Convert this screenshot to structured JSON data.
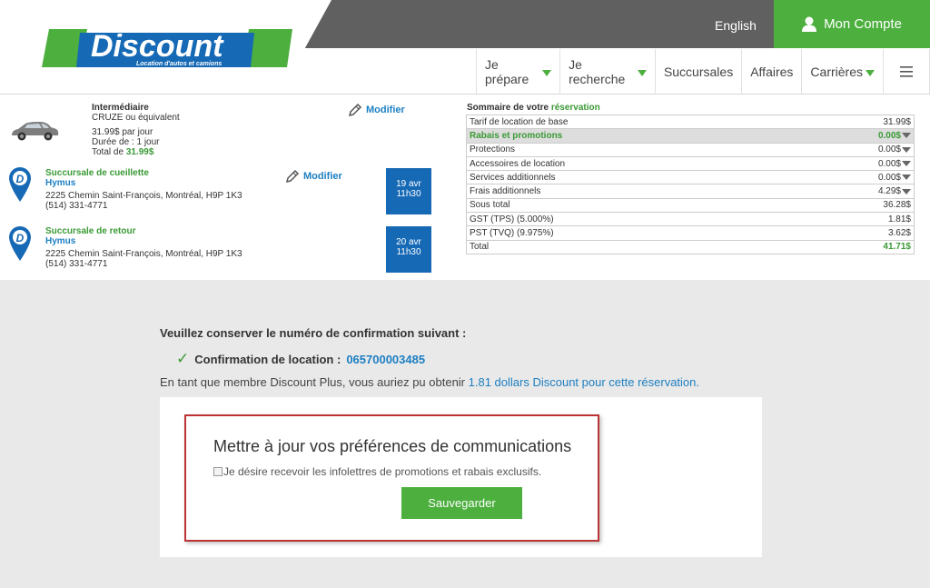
{
  "header": {
    "logo_text": "Discount",
    "logo_tagline": "Location d'autos et camions",
    "language_link": "English",
    "account_label": "Mon Compte",
    "nav": [
      {
        "label": "Je prépare",
        "dropdown": true
      },
      {
        "label": "Je recherche",
        "dropdown": true
      },
      {
        "label": "Succursales",
        "dropdown": false
      },
      {
        "label": "Affaires",
        "dropdown": false
      },
      {
        "label": "Carrières",
        "dropdown": true
      }
    ],
    "menu_icon": "hamburger-icon"
  },
  "vehicle": {
    "class": "Intermédiaire",
    "model": "CRUZE ou équivalent",
    "rate": "31.99$ par jour",
    "duration": "Durée de : 1 jour",
    "total_label": "Total de",
    "total_value": "31.99$",
    "modify_label": "Modifier"
  },
  "pickup": {
    "title": "Succursale de cueillette",
    "name": "Hymus",
    "address": "2225 Chemin Saint-François, Montréal, H9P 1K3",
    "phone": "(514) 331-4771",
    "date": "19 avr",
    "time": "11h30",
    "modify_label": "Modifier"
  },
  "return": {
    "title": "Succursale de retour",
    "name": "Hymus",
    "address": "2225 Chemin Saint-François, Montréal, H9P 1K3",
    "phone": "(514) 331-4771",
    "date": "20 avr",
    "time": "11h30"
  },
  "summary": {
    "title_prefix": "Sommaire de votre",
    "title_suffix": "réservation",
    "rows": [
      {
        "label": "Tarif de location de base",
        "value": "31.99$"
      },
      {
        "label": "Rabais et promotions",
        "value": "0.00$"
      },
      {
        "label": "Protections",
        "value": "0.00$"
      },
      {
        "label": "Accessoires de location",
        "value": "0.00$"
      },
      {
        "label": "Services additionnels",
        "value": "0.00$"
      },
      {
        "label": "Frais additionnels",
        "value": "4.29$"
      },
      {
        "label": "Sous total",
        "value": "36.28$"
      },
      {
        "label": "GST (TPS) (5.000%)",
        "value": "1.81$"
      },
      {
        "label": "PST (TVQ) (9.975%)",
        "value": "3.62$"
      },
      {
        "label": "Total",
        "value": "41.71$"
      }
    ]
  },
  "confirmation": {
    "intro": "Veuillez conserver le numéro de confirmation suivant :",
    "label": "Confirmation de location :",
    "number": "065700003485",
    "member_text": "En tant que membre Discount Plus, vous auriez pu obtenir",
    "member_link": "1.81 dollars Discount pour cette réservation."
  },
  "preferences": {
    "title": "Mettre à jour vos préférences de communications",
    "checkbox_label": "Je désire recevoir les infolettres de promotions et rabais exclusifs.",
    "save_label": "Sauvegarder"
  },
  "colors": {
    "brand_green": "#4caf3e",
    "brand_blue": "#1d7fc2",
    "date_blue": "#1669b5",
    "highlight_red": "#b33333"
  }
}
